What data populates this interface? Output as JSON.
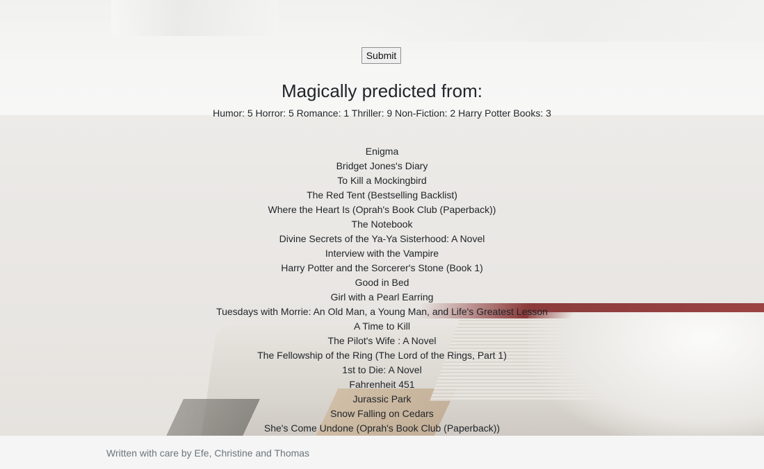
{
  "form": {
    "submit_label": "Submit"
  },
  "results": {
    "heading": "Magically predicted from:",
    "preferences_text": "Humor: 5 Horror: 5 Romance: 1 Thriller: 9 Non-Fiction: 2 Harry Potter Books: 3",
    "books": [
      "Enigma",
      "Bridget Jones's Diary",
      "To Kill a Mockingbird",
      "The Red Tent (Bestselling Backlist)",
      "Where the Heart Is (Oprah's Book Club (Paperback))",
      "The Notebook",
      "Divine Secrets of the Ya-Ya Sisterhood: A Novel",
      "Interview with the Vampire",
      "Harry Potter and the Sorcerer's Stone (Book 1)",
      "Good in Bed",
      "Girl with a Pearl Earring",
      "Tuesdays with Morrie: An Old Man, a Young Man, and Life's Greatest Lesson",
      "A Time to Kill",
      "The Pilot's Wife : A Novel",
      "The Fellowship of the Ring (The Lord of the Rings, Part 1)",
      "1st to Die: A Novel",
      "Fahrenheit 451",
      "Jurassic Park",
      "Snow Falling on Cedars",
      "She's Come Undone (Oprah's Book Club (Paperback))"
    ]
  },
  "footer": {
    "credit": "Written with care by Efe, Christine and Thomas"
  }
}
